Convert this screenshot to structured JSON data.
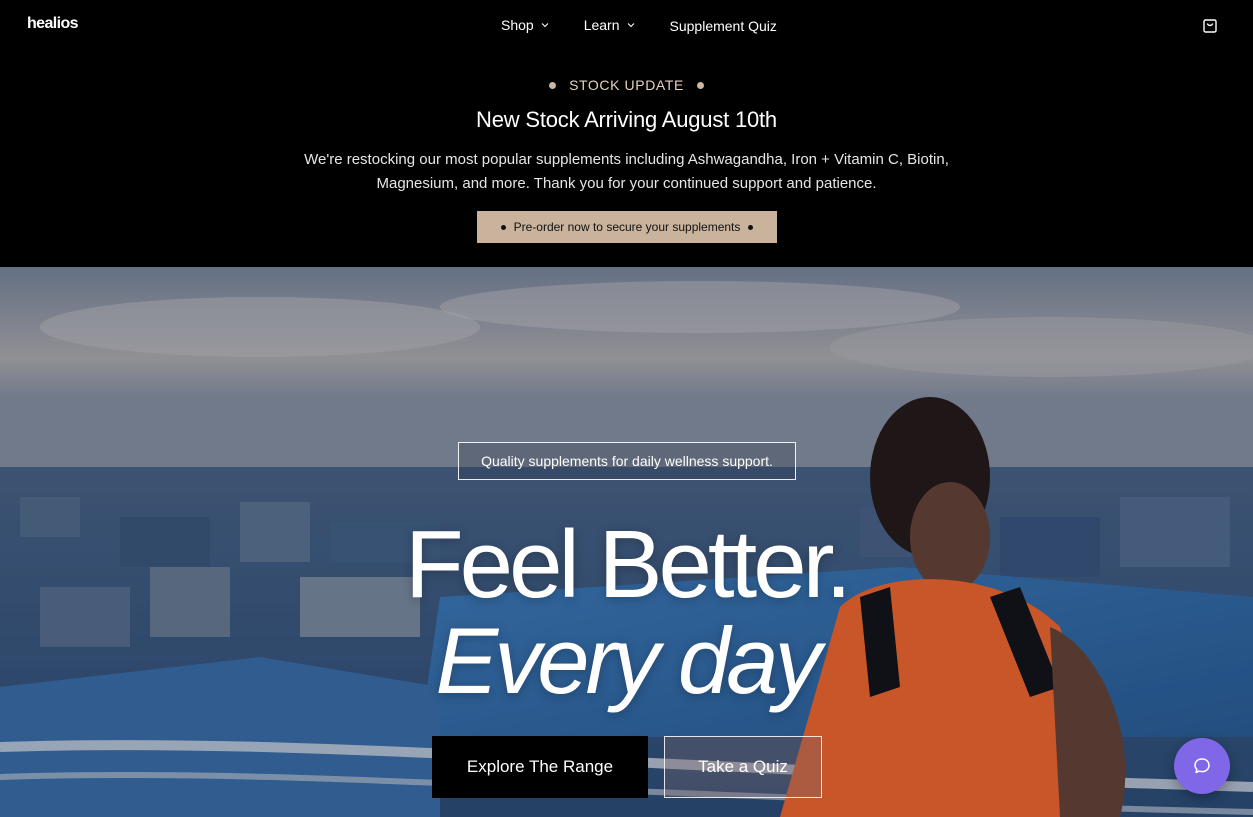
{
  "brand": {
    "logo_text": "healios"
  },
  "nav": {
    "items": [
      {
        "label": "Shop",
        "has_dropdown": true
      },
      {
        "label": "Learn",
        "has_dropdown": true
      },
      {
        "label": "Supplement Quiz",
        "has_dropdown": false
      }
    ],
    "cart_icon": "shopping-bag-icon"
  },
  "announcement": {
    "kicker": "STOCK UPDATE",
    "title": "New Stock Arriving August 10th",
    "body": "We're restocking our most popular supplements including Ashwagandha, Iron + Vitamin C, Biotin, Magnesium, and more. Thank you for your continued support and patience.",
    "cta": "Pre-order now to secure your supplements"
  },
  "hero": {
    "tagline": "Quality supplements for daily wellness support.",
    "headline_line1": "Feel Better.",
    "headline_line2": "Every day",
    "primary_button": "Explore The Range",
    "secondary_button": "Take a Quiz",
    "chat_icon": "chat-bubble-icon"
  },
  "colors": {
    "accent_tan": "#c9b39c",
    "chat_purple": "#7f67e8",
    "background": "#000000"
  }
}
